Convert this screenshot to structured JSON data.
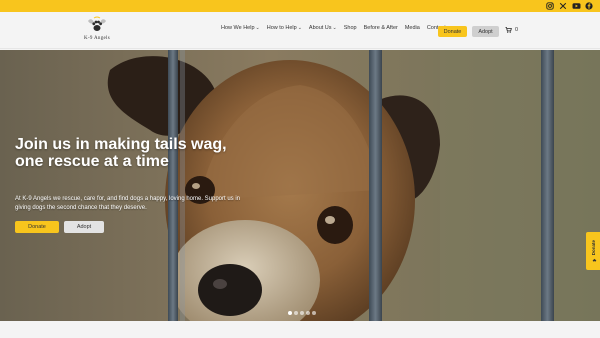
{
  "social": {
    "icons": [
      "instagram-icon",
      "x-icon",
      "youtube-icon",
      "facebook-icon"
    ]
  },
  "logo": {
    "text": "K-9 Angels"
  },
  "nav": {
    "items": [
      {
        "label": "How We Help",
        "has_dropdown": true
      },
      {
        "label": "How to Help",
        "has_dropdown": true
      },
      {
        "label": "About Us",
        "has_dropdown": true
      },
      {
        "label": "Shop",
        "has_dropdown": false
      },
      {
        "label": "Before & After",
        "has_dropdown": false
      },
      {
        "label": "Media",
        "has_dropdown": false
      },
      {
        "label": "Contact",
        "has_dropdown": false
      }
    ],
    "donate_label": "Donate",
    "adopt_label": "Adopt",
    "cart_count": "0"
  },
  "hero": {
    "title": "Join us in making tails wag, one rescue at a time",
    "text": "At K-9 Angels we rescue, care for, and find dogs a happy, loving home. Support us in giving dogs the second chance that they deserve.",
    "donate_label": "Donate",
    "adopt_label": "Adopt",
    "slides_total": 5,
    "active_slide": 1
  },
  "side_tab": {
    "label": "Donate"
  },
  "colors": {
    "accent": "#f8c51d",
    "secondary_button": "#cfcfcf",
    "text": "#333333"
  }
}
